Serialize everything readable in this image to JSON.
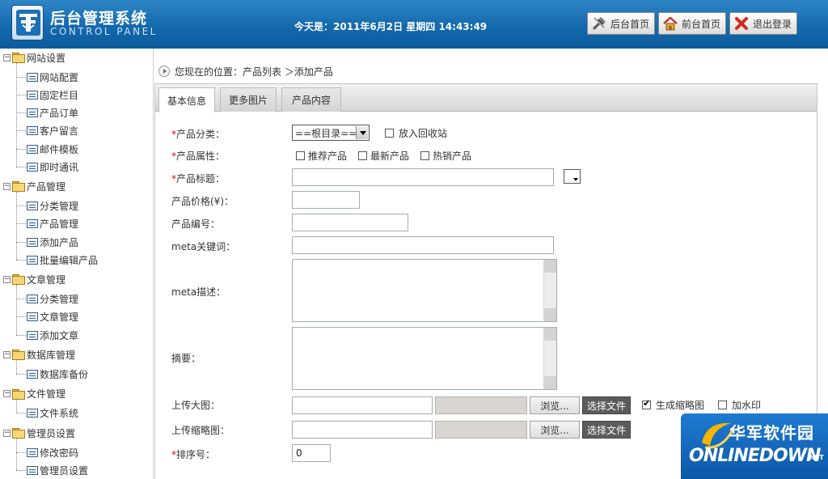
{
  "header": {
    "brand_title": "后台管理系统",
    "brand_sub": "CONTROL PANEL",
    "datetime": "今天是：2011年6月2日  星期四  14:43:49",
    "buttons": {
      "admin_home": "后台首页",
      "front_home": "前台首页",
      "logout": "退出登录"
    }
  },
  "sidebar": {
    "groups": [
      {
        "label": "网站设置",
        "items": [
          "网站配置",
          "固定栏目",
          "产品订单",
          "客户留言",
          "邮件模板",
          "即时通讯"
        ]
      },
      {
        "label": "产品管理",
        "items": [
          "分类管理",
          "产品管理",
          "添加产品",
          "批量编辑产品"
        ]
      },
      {
        "label": "文章管理",
        "items": [
          "分类管理",
          "文章管理",
          "添加文章"
        ]
      },
      {
        "label": "数据库管理",
        "items": [
          "数据库备份"
        ]
      },
      {
        "label": "文件管理",
        "items": [
          "文件系统"
        ]
      },
      {
        "label": "管理员设置",
        "items": [
          "修改密码",
          "管理员设置"
        ]
      }
    ],
    "toggle_symbol": "⊟"
  },
  "breadcrumb": "您现在的位置：产品列表 ＞添加产品",
  "tabs": [
    "基本信息",
    "更多图片",
    "产品内容"
  ],
  "form": {
    "required_mark": "*",
    "category_label": "产品分类：",
    "category_value": "==根目录==",
    "recycle_label": "放入回收站",
    "attr_label": "产品属性：",
    "attr_options": [
      "推荐产品",
      "最新产品",
      "热销产品"
    ],
    "title_label": "产品标题：",
    "title_value": "",
    "price_label": "产品价格(¥)：",
    "price_value": "",
    "code_label": "产品编号：",
    "code_value": "",
    "meta_kw_label": "meta关键词：",
    "meta_kw_value": "",
    "meta_desc_label": "meta描述：",
    "summary_label": "摘要：",
    "upload_big_label": "上传大图：",
    "upload_thumb_label": "上传缩略图：",
    "browse_label": "浏览...",
    "pick_file_label": "选择文件",
    "gen_thumb_label": "生成缩略图",
    "gen_thumb_checked": true,
    "watermark_label": "加水印",
    "watermark_checked": false,
    "sort_label": "排序号：",
    "sort_value": "0"
  },
  "watermark_logo": {
    "cn": "华军软件园",
    "en": "ONLINEDOWN",
    "suffix": ".NET"
  },
  "colors": {
    "header_bg": "#1469ad",
    "required": "#dd0000",
    "pick_button": "#5c5c5c"
  }
}
